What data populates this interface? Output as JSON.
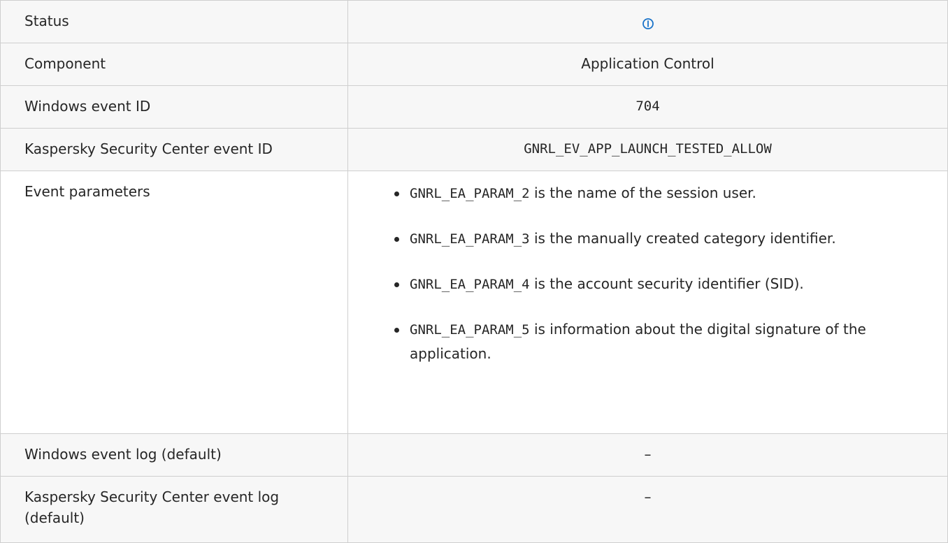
{
  "rows": {
    "status": {
      "label": "Status",
      "icon": "info-icon"
    },
    "component": {
      "label": "Component",
      "value": "Application Control"
    },
    "windows_event_id": {
      "label": "Windows event ID",
      "value": "704"
    },
    "ksc_event_id": {
      "label": "Kaspersky Security Center event ID",
      "value": "GNRL_EV_APP_LAUNCH_TESTED_ALLOW"
    },
    "event_parameters": {
      "label": "Event parameters",
      "items": [
        {
          "code": "GNRL_EA_PARAM_2",
          "text": " is the name of the session user."
        },
        {
          "code": "GNRL_EA_PARAM_3",
          "text": " is the manually created category identifier."
        },
        {
          "code": "GNRL_EA_PARAM_4",
          "text": " is the account security identifier (SID)."
        },
        {
          "code": "GNRL_EA_PARAM_5",
          "text": " is information about the digital signature of the application."
        }
      ]
    },
    "windows_event_log": {
      "label": "Windows event log (default)",
      "value": "–"
    },
    "ksc_event_log": {
      "label": "Kaspersky Security Center event log (default)",
      "value": "–"
    }
  },
  "colors": {
    "accent": "#1a73c9",
    "border": "#cfcfcf",
    "text": "#262626"
  }
}
